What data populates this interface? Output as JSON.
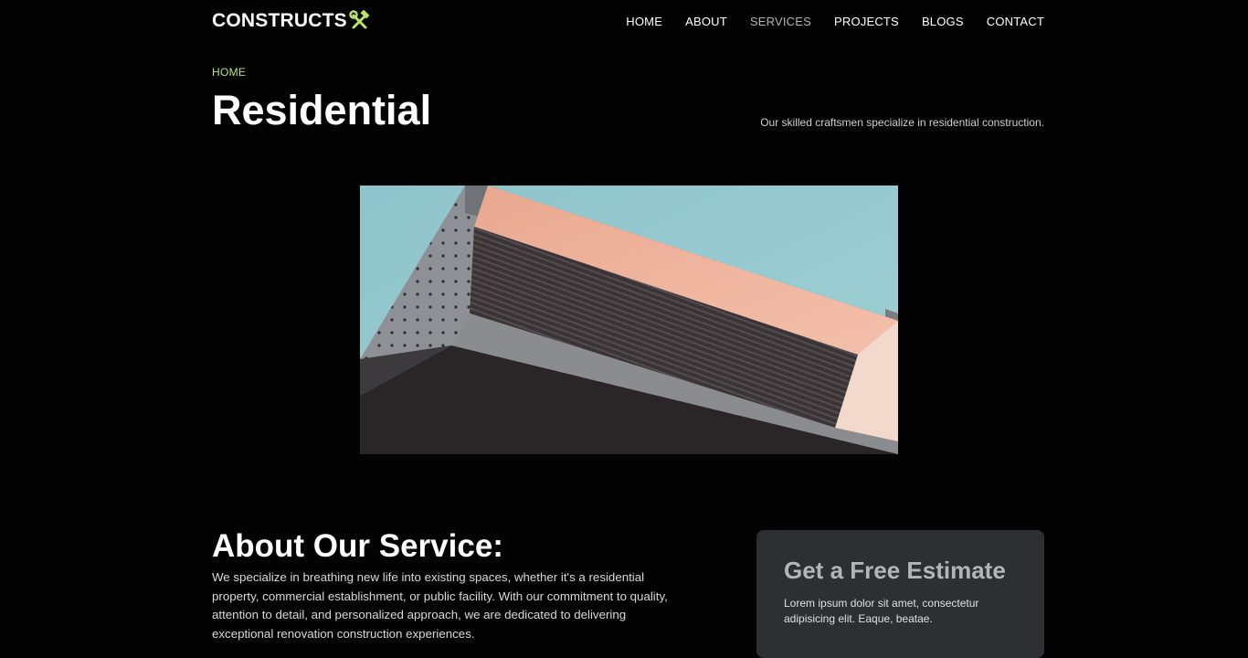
{
  "brand": {
    "name": "CONSTRUCTS",
    "accent": "#b9e36c",
    "logo_icon": "hammer-wrench-icon"
  },
  "nav": {
    "items": [
      {
        "label": "HOME"
      },
      {
        "label": "ABOUT"
      },
      {
        "label": "SERVICES"
      },
      {
        "label": "PROJECTS"
      },
      {
        "label": "BLOGS"
      },
      {
        "label": "CONTACT"
      }
    ],
    "active": "SERVICES"
  },
  "page": {
    "breadcrumb": "HOME",
    "title": "Residential",
    "tagline": "Our skilled craftsmen specialize in residential construction."
  },
  "about": {
    "heading": "About Our Service:",
    "text": "We specialize in breathing new life into existing spaces, whether it's a residential property, commercial establishment, or public facility. With our commitment to quality, attention to detail, and personalized approach, we are dedicated to delivering exceptional renovation construction experiences."
  },
  "estimate": {
    "title": "Get a Free Estimate",
    "text": "Lorem ipsum dolor sit amet, consectetur adipisicing elit. Eaque, beatae."
  }
}
